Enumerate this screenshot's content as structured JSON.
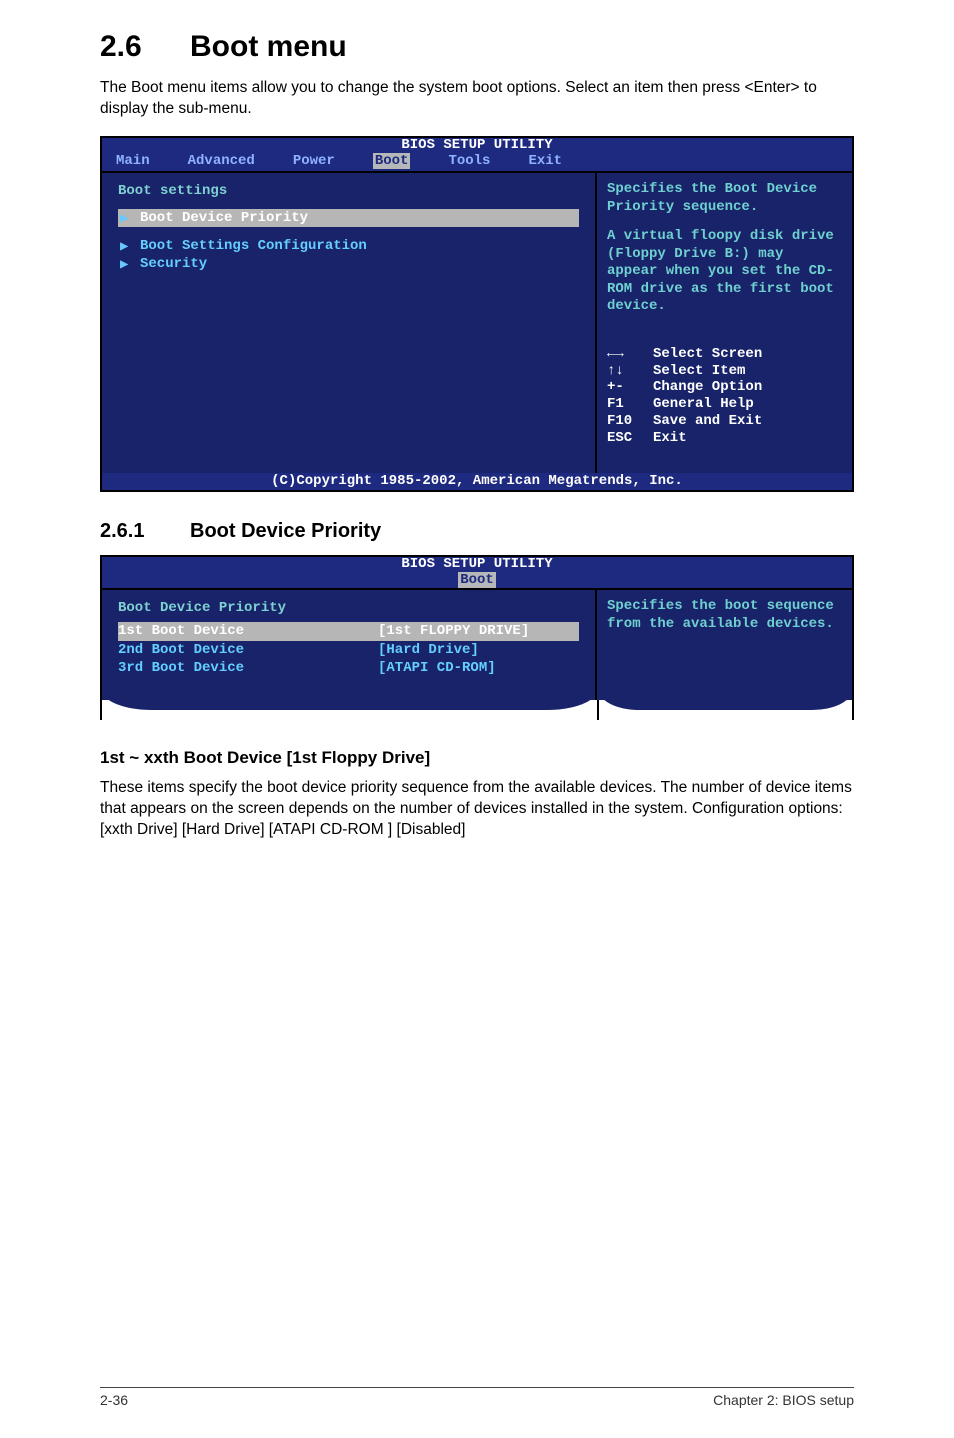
{
  "sectionNumber": "2.6",
  "sectionTitle": "Boot menu",
  "intro": "The Boot menu items allow you to change the system boot options. Select an item then press <Enter> to display the sub-menu.",
  "bios1": {
    "title": "BIOS SETUP UTILITY",
    "tabs": [
      "Main",
      "Advanced",
      "Power",
      "Boot",
      "Tools",
      "Exit"
    ],
    "activeTab": "Boot",
    "heading": "Boot settings",
    "items": [
      {
        "label": "Boot Device Priority",
        "highlight": true
      },
      {
        "label": "Boot Settings Configuration",
        "highlight": false
      },
      {
        "label": "Security",
        "highlight": false
      }
    ],
    "helpTop": "Specifies the Boot Device Priority sequence.",
    "helpPara2": "A virtual floopy disk drive (Floppy Drive B:) may appear when you set the CD-ROM drive as the first boot device.",
    "keys": [
      {
        "k": "←→",
        "v": "Select Screen"
      },
      {
        "k": "↑↓",
        "v": "Select Item"
      },
      {
        "k": "+-",
        "v": "Change Option"
      },
      {
        "k": "F1",
        "v": "General Help"
      },
      {
        "k": "F10",
        "v": "Save and Exit"
      },
      {
        "k": "ESC",
        "v": "Exit"
      }
    ],
    "copyright": "(C)Copyright 1985-2002, American Megatrends, Inc."
  },
  "subsectionNumber": "2.6.1",
  "subsectionTitle": "Boot Device Priority",
  "bios2": {
    "title": "BIOS SETUP UTILITY",
    "activeTab": "Boot",
    "heading": "Boot Device Priority",
    "helpTop": "Specifies the boot sequence from the available devices.",
    "rows": [
      {
        "label": "1st Boot Device",
        "value": "[1st FLOPPY DRIVE]",
        "highlight": true
      },
      {
        "label": "2nd Boot Device",
        "value": "[Hard Drive]",
        "highlight": false
      },
      {
        "label": "3rd Boot Device",
        "value": "[ATAPI CD-ROM]",
        "highlight": false
      }
    ]
  },
  "optionHeading": "1st ~ xxth Boot Device [1st Floppy Drive]",
  "optionText": "These items specify the boot device priority sequence from the available devices. The number of device items that appears on the screen depends on the number of devices installed in the system. Configuration options: [xxth Drive] [Hard Drive] [ATAPI CD-ROM  ] [Disabled]",
  "footerLeft": "2-36",
  "footerRight": "Chapter 2: BIOS setup"
}
